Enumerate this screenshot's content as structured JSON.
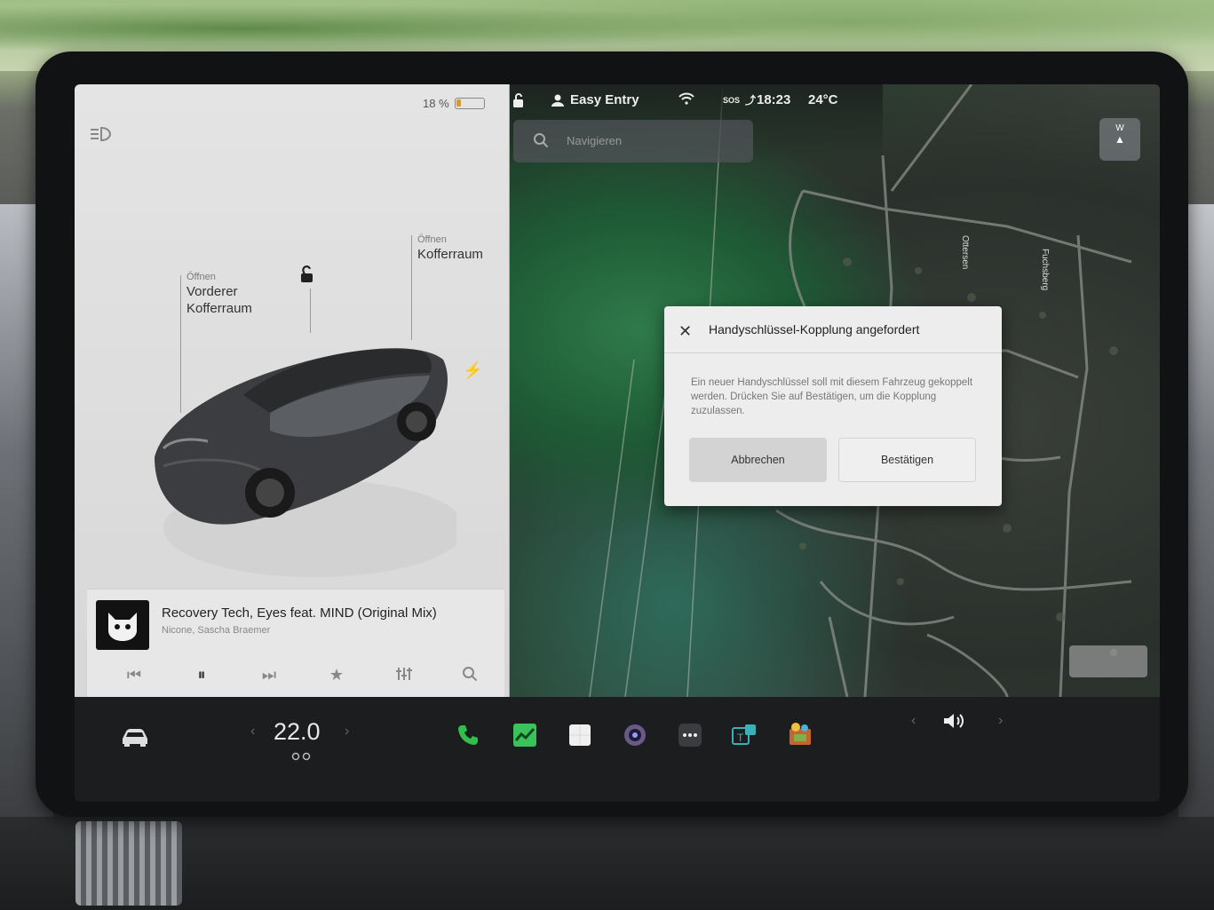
{
  "status_bar": {
    "battery_percent_label": "18 %",
    "battery_level": 0.18,
    "profile_name": "Easy Entry",
    "sos_label": "SOS",
    "time": "18:23",
    "outside_temp": "24°C"
  },
  "search": {
    "placeholder": "Navigieren"
  },
  "compass": {
    "letters": "W",
    "arrow": "▲"
  },
  "car_panel": {
    "front_trunk_action": "Öffnen",
    "front_trunk_label_line1": "Vorderer",
    "front_trunk_label_line2": "Kofferraum",
    "trunk_action": "Öffnen",
    "trunk_label": "Kofferraum"
  },
  "media": {
    "track_title": "Recovery Tech, Eyes feat. MIND (Original Mix)",
    "track_artist": "Nicone, Sascha Braemer",
    "controls": {
      "prev_icon": "skip-previous-icon",
      "pause_icon": "pause-icon",
      "next_icon": "skip-next-icon",
      "favorite_icon": "star-icon",
      "equalizer_icon": "equalizer-icon",
      "search_icon": "search-icon"
    }
  },
  "dialog": {
    "title": "Handyschlüssel-Kopplung angefordert",
    "body": "Ein neuer Handyschlüssel soll mit diesem Fahrzeug gekoppelt werden. Drücken Sie auf Bestätigen, um die Kopplung zuzulassen.",
    "cancel_label": "Abbrechen",
    "confirm_label": "Bestätigen"
  },
  "dock": {
    "cabin_temp": "22.0",
    "prev_arrow": "‹",
    "next_arrow": "›",
    "apps": [
      "phone-icon",
      "energy-icon",
      "notepad-icon",
      "camera-icon",
      "more-icon",
      "calendar-icon",
      "toybox-icon"
    ],
    "volume_icon": "volume-icon"
  },
  "map": {
    "street_labels": [
      "Ottersen",
      "Fuchsberg"
    ]
  },
  "colors": {
    "phone_green": "#2fbf4a",
    "energy_green": "#3cc25a",
    "battery_amber": "#d39a3a",
    "dialog_bg": "#ededed"
  }
}
